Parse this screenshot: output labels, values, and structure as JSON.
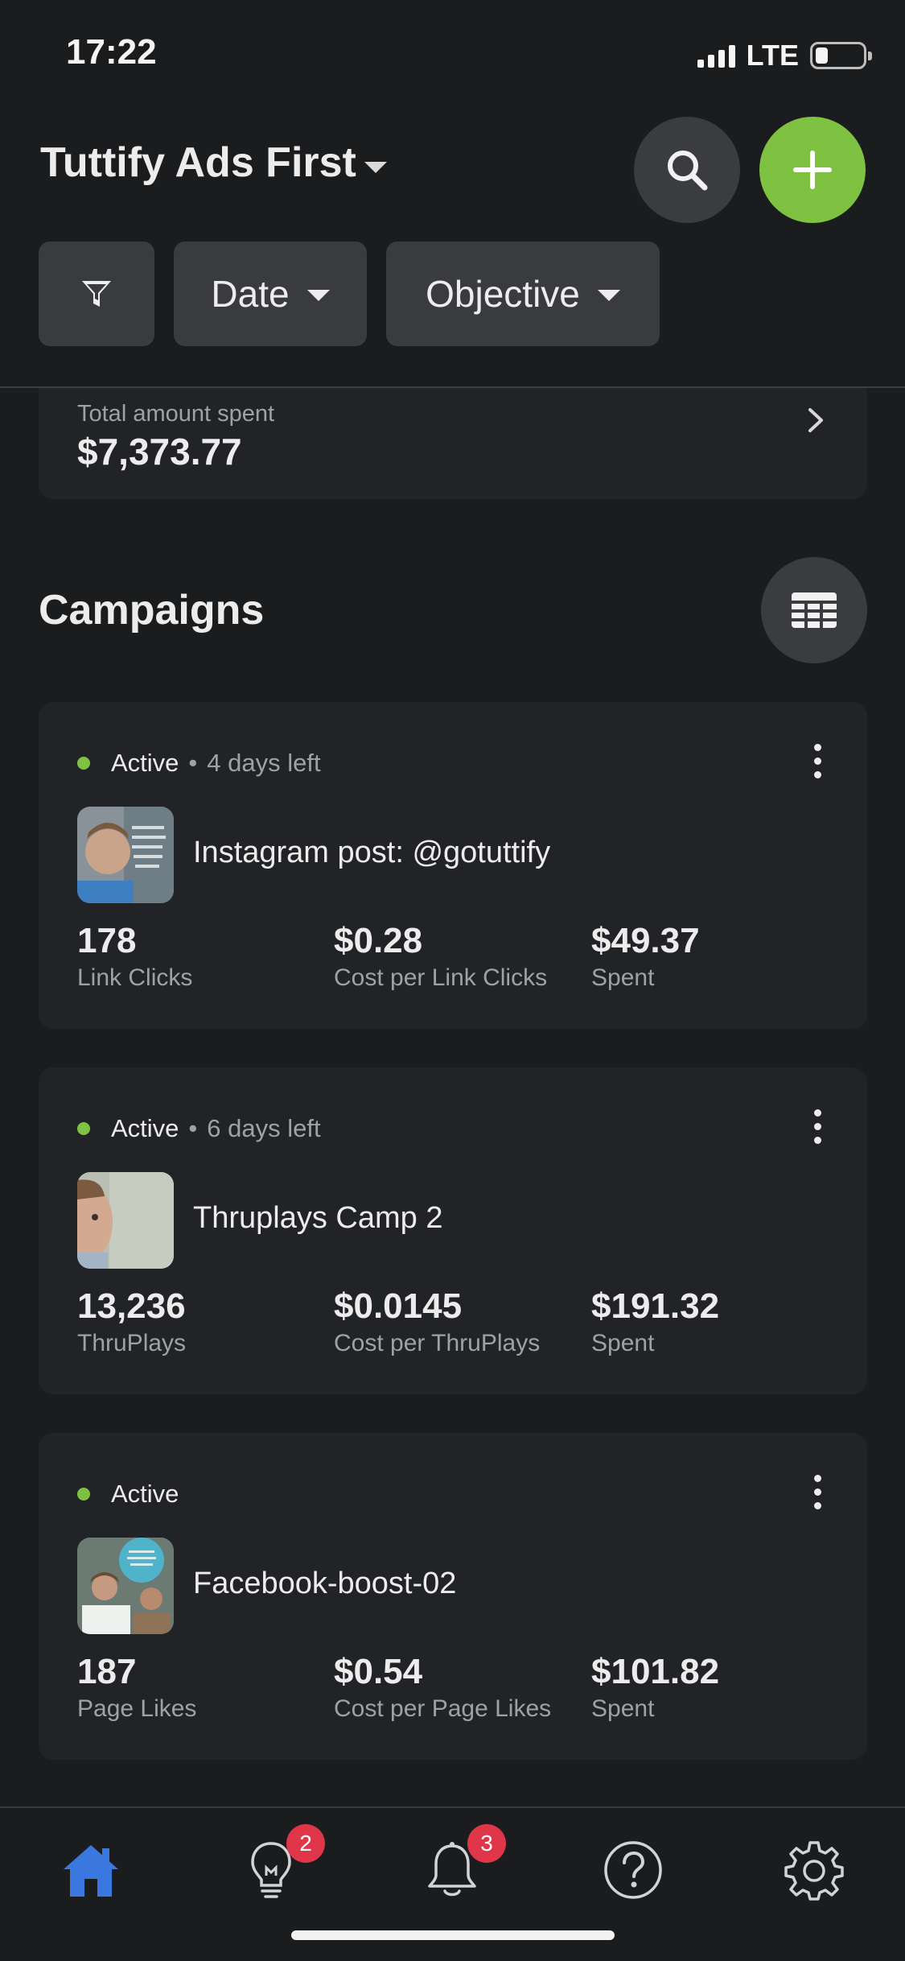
{
  "status_bar": {
    "time": "17:22",
    "network": "LTE",
    "battery_level": 0.25
  },
  "header": {
    "account_title": "Tuttify Ads First",
    "filters": [
      {
        "label": "",
        "icon": "filter-icon"
      },
      {
        "label": "Date",
        "icon": "chevron-down-icon"
      },
      {
        "label": "Objective",
        "icon": "chevron-down-icon"
      }
    ]
  },
  "summary": {
    "label": "Total amount spent",
    "value": "$7,373.77"
  },
  "campaigns_section": {
    "title": "Campaigns"
  },
  "campaigns": [
    {
      "status": "Active",
      "separator": "•",
      "days_left": "4 days left",
      "name": "Instagram post: @gotuttify",
      "metrics": [
        {
          "value": "178",
          "label": "Link Clicks"
        },
        {
          "value": "$0.28",
          "label": "Cost per Link Clicks"
        },
        {
          "value": "$49.37",
          "label": "Spent"
        }
      ]
    },
    {
      "status": "Active",
      "separator": "•",
      "days_left": "6 days left",
      "name": "Thruplays Camp 2",
      "metrics": [
        {
          "value": "13,236",
          "label": "ThruPlays"
        },
        {
          "value": "$0.0145",
          "label": "Cost per ThruPlays"
        },
        {
          "value": "$191.32",
          "label": "Spent"
        }
      ]
    },
    {
      "status": "Active",
      "name": "Facebook-boost-02",
      "metrics": [
        {
          "value": "187",
          "label": "Page Likes"
        },
        {
          "value": "$0.54",
          "label": "Cost per Page Likes"
        },
        {
          "value": "$101.82",
          "label": "Spent"
        }
      ]
    }
  ],
  "tabbar": {
    "tabs": [
      {
        "icon": "home-icon",
        "active": true
      },
      {
        "icon": "lightbulb-icon",
        "badge": "2"
      },
      {
        "icon": "bell-icon",
        "badge": "3"
      },
      {
        "icon": "help-icon"
      },
      {
        "icon": "settings-gear-icon"
      }
    ]
  },
  "colors": {
    "background": "#1b1c1e",
    "card": "#222326",
    "accent_green": "#7fc241",
    "active_blue": "#3a78e0",
    "badge_red": "#e0364a"
  }
}
